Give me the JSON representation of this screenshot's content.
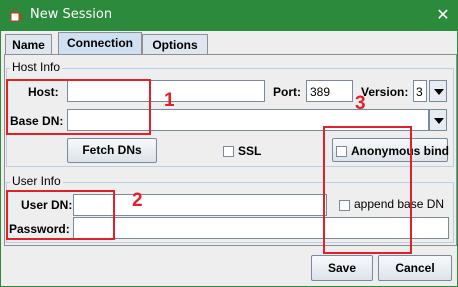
{
  "window": {
    "title": "New Session",
    "close_glyph": "✕"
  },
  "tabs": [
    {
      "label": "Name",
      "active": false
    },
    {
      "label": "Connection",
      "active": true
    },
    {
      "label": "Options",
      "active": false
    }
  ],
  "host_info": {
    "group_label": "Host Info",
    "host_label": "Host:",
    "host_value": "",
    "port_label": "Port:",
    "port_value": "389",
    "version_label": "Version:",
    "version_value": "3",
    "base_dn_label": "Base DN:",
    "base_dn_value": "",
    "fetch_dns_label": "Fetch DNs",
    "ssl_label": "SSL",
    "ssl_checked": false,
    "anonymous_bind_label": "Anonymous bind",
    "anonymous_bind_checked": false
  },
  "user_info": {
    "group_label": "User Info",
    "user_dn_label": "User DN:",
    "user_dn_value": "",
    "append_base_dn_label": "append base DN",
    "append_base_dn_checked": false,
    "password_label": "Password:",
    "password_value": ""
  },
  "footer": {
    "save_label": "Save",
    "cancel_label": "Cancel"
  },
  "annotations": {
    "color": "#e0202a",
    "labels": [
      "1",
      "2",
      "3"
    ]
  },
  "colors": {
    "titlebar": "#2b8a3b",
    "annotation": "#e0202a"
  }
}
